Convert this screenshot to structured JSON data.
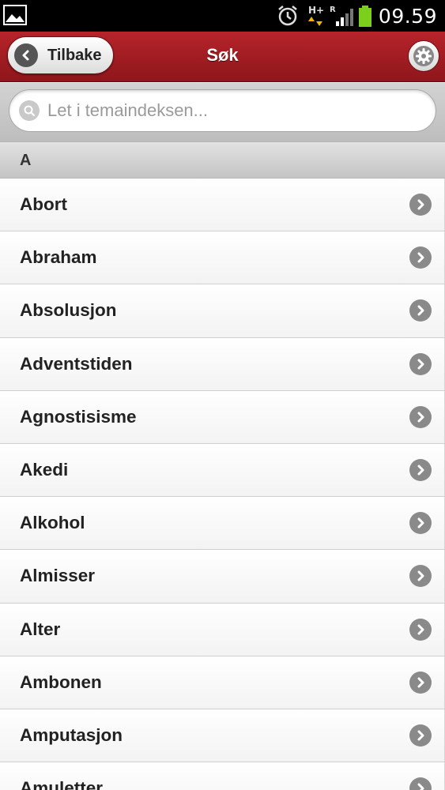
{
  "status_bar": {
    "time": "09.59",
    "icons": [
      "gallery-icon",
      "alarm-icon",
      "hplus-data-icon",
      "signal-icon",
      "battery-icon"
    ],
    "hplus_text": "H+",
    "roaming_text": "R",
    "battery_color": "#7ccf1b"
  },
  "header": {
    "back_label": "Tilbake",
    "title": "Søk",
    "bg_color": "#a11d22"
  },
  "search": {
    "placeholder": "Let i temaindeksen..."
  },
  "section": {
    "label": "A"
  },
  "list": {
    "items": [
      {
        "label": "Abort"
      },
      {
        "label": "Abraham"
      },
      {
        "label": "Absolusjon"
      },
      {
        "label": "Adventstiden"
      },
      {
        "label": "Agnostisisme"
      },
      {
        "label": "Akedi"
      },
      {
        "label": "Alkohol"
      },
      {
        "label": "Almisser"
      },
      {
        "label": "Alter"
      },
      {
        "label": "Ambonen"
      },
      {
        "label": "Amputasjon"
      },
      {
        "label": "Amuletter"
      }
    ]
  }
}
